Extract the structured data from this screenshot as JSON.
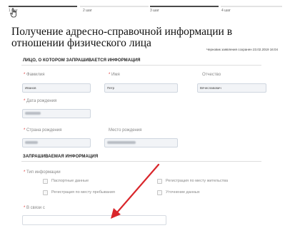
{
  "steps": [
    {
      "label": "1 шаг",
      "active": true
    },
    {
      "label": "2 шаг",
      "active": false
    },
    {
      "label": "3 шаг",
      "active": true
    },
    {
      "label": "4 шаг",
      "active": false
    }
  ],
  "page_title": "Получение адресно-справочной информации в отношении физического лица",
  "draft_note": "Черновик заявления сохранен 23.02.2019 16:04",
  "person_section": {
    "heading": "ЛИЦО, О КОТОРОМ ЗАПРАШИВАЕТСЯ ИНФОРМАЦИЯ",
    "surname": {
      "label": "Фамилия",
      "value": "Иванов",
      "required": "*"
    },
    "name": {
      "label": "Имя",
      "value": "Петр",
      "required": "*"
    },
    "patronymic": {
      "label": "Отчество",
      "value": "Вячеславович"
    },
    "birth_date": {
      "label": "Дата рождения",
      "required": "*"
    },
    "birth_country": {
      "label": "Страна рождения",
      "required": "*"
    },
    "birth_place": {
      "label": "Место рождения"
    }
  },
  "request_section": {
    "heading": "ЗАПРАШИВАЕМАЯ ИНФОРМАЦИЯ",
    "info_type_label": "Тип информации",
    "info_type_required": "*",
    "options": [
      {
        "label": "Паспортные данные"
      },
      {
        "label": "Регистрация по месту жительства"
      },
      {
        "label": "Регистрация по месту пребывания"
      },
      {
        "label": "Уточнение данных"
      }
    ],
    "reason_label": "В связи с",
    "reason_required": "*",
    "reason_value": ""
  },
  "icons": {
    "cursor": "hand-pointer-icon",
    "annotation": "red-arrow"
  },
  "colors": {
    "arrow": "#d9262b",
    "required": "#dd3333",
    "input_border": "#cfd6df"
  }
}
